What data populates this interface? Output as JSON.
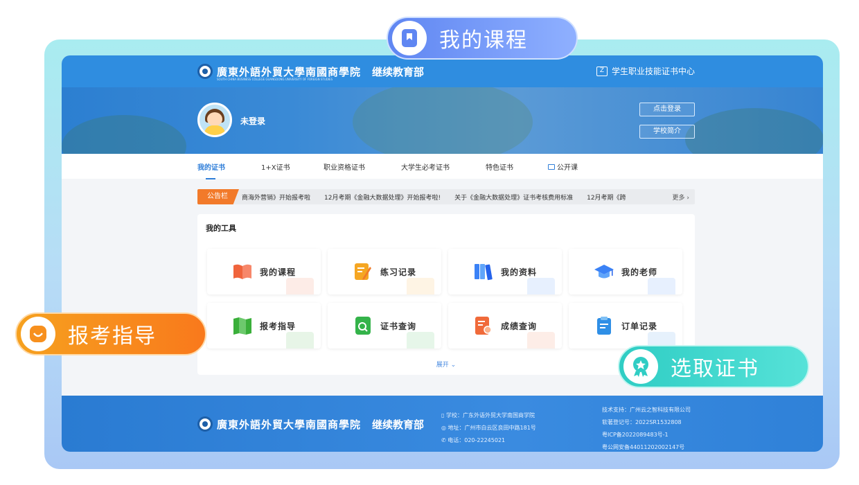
{
  "header": {
    "school_name": "廣東外語外貿大學南國商學院",
    "school_name_en": "SOUTH CHINA BUSINESS COLLEGE GUANGDONG UNIVERSITY OF FOREIGN STUDIES",
    "department": "继续教育部",
    "cert_center_label": "学生职业技能证书中心"
  },
  "banner": {
    "username": "未登录",
    "login_button": "点击登录",
    "intro_button": "学校简介"
  },
  "nav": {
    "items": [
      "我的证书",
      "1+X证书",
      "职业资格证书",
      "大学生必考证书",
      "特色证书",
      "公开课"
    ],
    "active_index": 0
  },
  "notice": {
    "tag": "公告栏",
    "items": [
      "商海外营销》开始报考啦",
      "12月考期《金融大数据处理》开始报考啦!",
      "关于《金融大数据处理》证书考核费用标准",
      "12月考期《跨"
    ],
    "more": "更多 ›"
  },
  "tools": {
    "title": "我的工具",
    "items": [
      {
        "label": "我的课程",
        "icon": "book-icon",
        "color": "#f0643c"
      },
      {
        "label": "练习记录",
        "icon": "pencil-icon",
        "color": "#f5a623"
      },
      {
        "label": "我的资料",
        "icon": "folders-icon",
        "color": "#3b82f6"
      },
      {
        "label": "我的老师",
        "icon": "graduation-cap-icon",
        "color": "#3b82f6"
      },
      {
        "label": "报考指导",
        "icon": "map-icon",
        "color": "#3aaf3a"
      },
      {
        "label": "证书查询",
        "icon": "search-doc-icon",
        "color": "#34b34a"
      },
      {
        "label": "成绩查询",
        "icon": "score-doc-icon",
        "color": "#f06a3a"
      },
      {
        "label": "订单记录",
        "icon": "clipboard-icon",
        "color": "#2f8fe6"
      }
    ],
    "expand": "展开 ⌄"
  },
  "footer": {
    "school_label": "学校：广东外语外贸大学南国商学院",
    "address": "地址：广州市白云区良田中路181号",
    "phone": "电话：020-22245021",
    "tech_support": "技术支持：广州云之智科技有限公司",
    "software_reg": "软著登记号：2022SR1532808",
    "icp": "粤ICP备2022089483号-1",
    "police": "粤公网安备44011202002147号"
  },
  "callouts": {
    "my_courses": "我的课程",
    "exam_guide": "报考指导",
    "select_cert": "选取证书"
  },
  "colors": {
    "primary": "#2f8de0",
    "accent_orange": "#f7901e",
    "accent_teal": "#34d1c8",
    "callout_blue": "#6b8df5"
  }
}
